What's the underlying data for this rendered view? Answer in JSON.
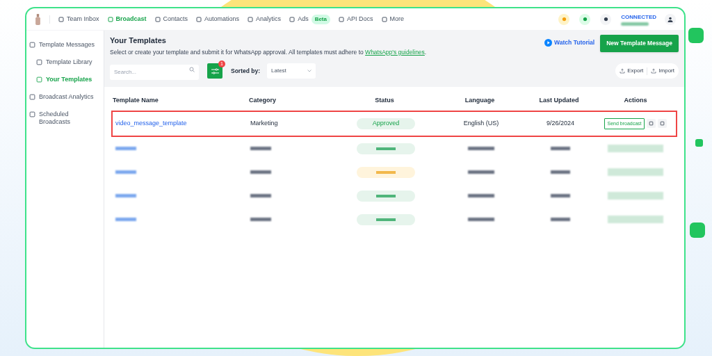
{
  "nav": {
    "items": [
      {
        "label": "Team Inbox",
        "selected": false
      },
      {
        "label": "Broadcast",
        "selected": true
      },
      {
        "label": "Contacts",
        "selected": false
      },
      {
        "label": "Automations",
        "selected": false
      },
      {
        "label": "Analytics",
        "selected": false
      },
      {
        "label": "Ads",
        "badge": "Beta",
        "selected": false
      },
      {
        "label": "API Docs",
        "selected": false
      },
      {
        "label": "More",
        "selected": false
      }
    ],
    "connection": "CONNECTED"
  },
  "sidebar": {
    "items": [
      {
        "label": "Template Messages",
        "selected": false,
        "children": [
          {
            "label": "Template Library",
            "selected": false
          },
          {
            "label": "Your Templates",
            "selected": true
          }
        ]
      },
      {
        "label": "Broadcast Analytics",
        "selected": false
      },
      {
        "label": "Scheduled Broadcasts",
        "selected": false
      }
    ]
  },
  "header": {
    "title": "Your Templates",
    "description": "Select or create your template and submit it for WhatsApp approval. All templates must adhere to ",
    "link": "WhatsApp's guidelines",
    "tail": ".",
    "watch_tutorial": "Watch Tutorial",
    "new_button": "New Template Message"
  },
  "toolbar": {
    "search_placeholder": "Search...",
    "filter_badge": "1",
    "sort_label": "Sorted by:",
    "sort_value": "Latest",
    "export": "Export",
    "import": "Import"
  },
  "table": {
    "columns": [
      "Template Name",
      "Category",
      "Status",
      "Language",
      "Last Updated",
      "Actions"
    ],
    "rows": [
      {
        "name": "video_message_template",
        "category": "Marketing",
        "status": "Approved",
        "language": "English (US)",
        "updated": "9/26/2024",
        "action": "Send broadcast",
        "highlighted": true
      }
    ],
    "blurred_rows": [
      {
        "kind": "approved"
      },
      {
        "kind": "pending"
      },
      {
        "kind": "approved"
      },
      {
        "kind": "approved"
      }
    ]
  }
}
